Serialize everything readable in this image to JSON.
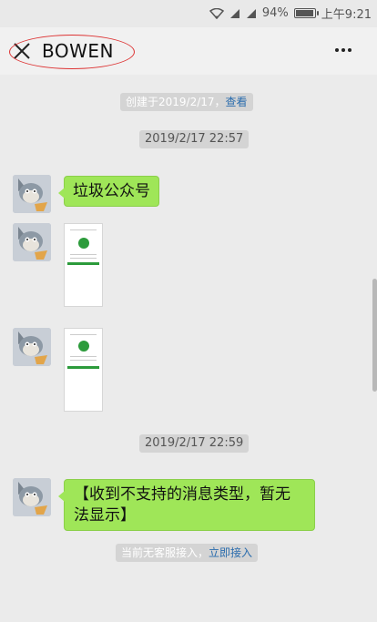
{
  "status_bar": {
    "battery": "94%",
    "battery_level": 0.94,
    "time": "上午9:21"
  },
  "header": {
    "title": "BOWEN"
  },
  "notices": {
    "created_text": "创建于2019/2/17，",
    "created_link": "查看",
    "time1": "2019/2/17 22:57",
    "time2": "2019/2/17 22:59",
    "no_agent_text": "当前无客服接入，",
    "no_agent_link": "立即接入"
  },
  "messages": {
    "m1": {
      "text": "垃圾公众号"
    },
    "m4": {
      "text": "【收到不支持的消息类型，暂无法显示】"
    }
  },
  "colors": {
    "bubble": "#9fe658",
    "link": "#2a6cad",
    "highlight": "#dd3333"
  }
}
